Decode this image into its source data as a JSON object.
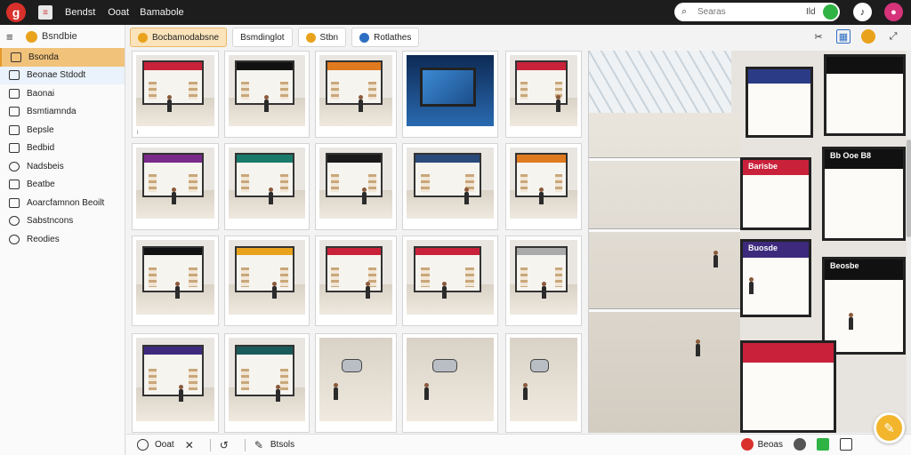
{
  "topbar": {
    "logo": "g",
    "icon_label": "≡",
    "items": [
      "Bendst",
      "Ooat",
      "Bamabole"
    ],
    "search_value": "",
    "search_placeholder": "Searas",
    "search_shortcut": "Ild",
    "user_icon": "person-icon",
    "notify_icon": "bell-icon"
  },
  "sidebar": {
    "title": "Bsndbie",
    "items": [
      {
        "label": "Bsonda",
        "icon": "rect-icon",
        "state": "active"
      },
      {
        "label": "Beonae Stdodt",
        "icon": "rect-icon",
        "state": "hover"
      },
      {
        "label": "Baonai",
        "icon": "rect-icon",
        "state": ""
      },
      {
        "label": "Bsmtiamnda",
        "icon": "rect-icon",
        "state": ""
      },
      {
        "label": "Bepsle",
        "icon": "rect-icon",
        "state": ""
      },
      {
        "label": "Bedbid",
        "icon": "rect-icon",
        "state": ""
      },
      {
        "label": "Nadsbeis",
        "icon": "circle-icon",
        "state": ""
      },
      {
        "label": "Beatbe",
        "icon": "rect-icon",
        "state": ""
      },
      {
        "label": "Aoarcfamnon Beoilt",
        "icon": "rect-icon",
        "state": ""
      },
      {
        "label": "Sabstncons",
        "icon": "circle-icon",
        "state": ""
      },
      {
        "label": "Reodies",
        "icon": "circle-icon",
        "state": ""
      }
    ]
  },
  "tabs": [
    {
      "label": "Bocbamodabsne",
      "color": "#e9a21b",
      "active": true
    },
    {
      "label": "Bsmdinglot",
      "color": "",
      "active": false
    },
    {
      "label": "Stbn",
      "color": "#e9a21b",
      "active": false
    },
    {
      "label": "Rotlathes",
      "color": "#2d6fc2",
      "active": false
    }
  ],
  "gallery": {
    "captions": [
      "i",
      "",
      "",
      "",
      "",
      "",
      "",
      "",
      "",
      "",
      "",
      "",
      "",
      "",
      "",
      "",
      "",
      "",
      "",
      ""
    ]
  },
  "atrium": {
    "signs": [
      "Barisbe",
      "Buosde",
      "Bb Ooe B8",
      "Beosbe"
    ]
  },
  "bottombar": {
    "left_label": "Ooat",
    "tool_label": "Btsols",
    "right_label": "Beoas"
  },
  "colors": {
    "accent": "#e9a21b",
    "active_item": "#f1c27a",
    "topbar": "#1d1d1d",
    "brand_red": "#d9302b"
  }
}
